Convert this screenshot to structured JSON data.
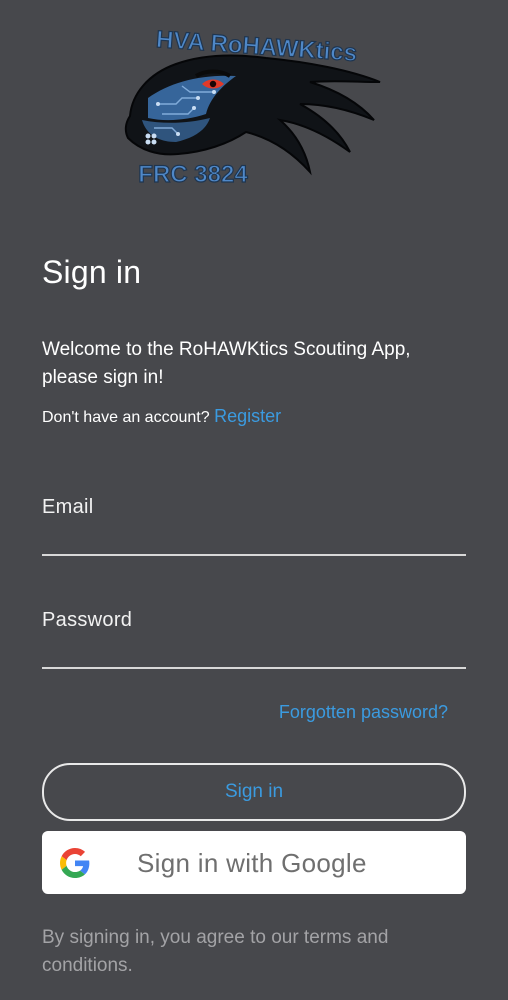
{
  "logo": {
    "top_text": "HVA RoHAWKtics",
    "bottom_text": "FRC 3824",
    "icon": "hawk-head-logo"
  },
  "auth": {
    "title": "Sign in",
    "welcome": "Welcome to the RoHAWKtics Scouting App, please sign in!",
    "no_account_text": "Don't have an account?",
    "register_label": "Register",
    "email_label": "Email",
    "email_value": "",
    "password_label": "Password",
    "password_value": "",
    "forgot_label": "Forgotten password?",
    "signin_label": "Sign in",
    "google_label": "Sign in with Google",
    "google_icon": "google-g-icon",
    "terms": "By signing in, you agree to our terms and conditions."
  },
  "colors": {
    "background": "#47484c",
    "link": "#3b9be0",
    "muted": "#a3a3a6",
    "logo_blue": "#4f88c8"
  }
}
